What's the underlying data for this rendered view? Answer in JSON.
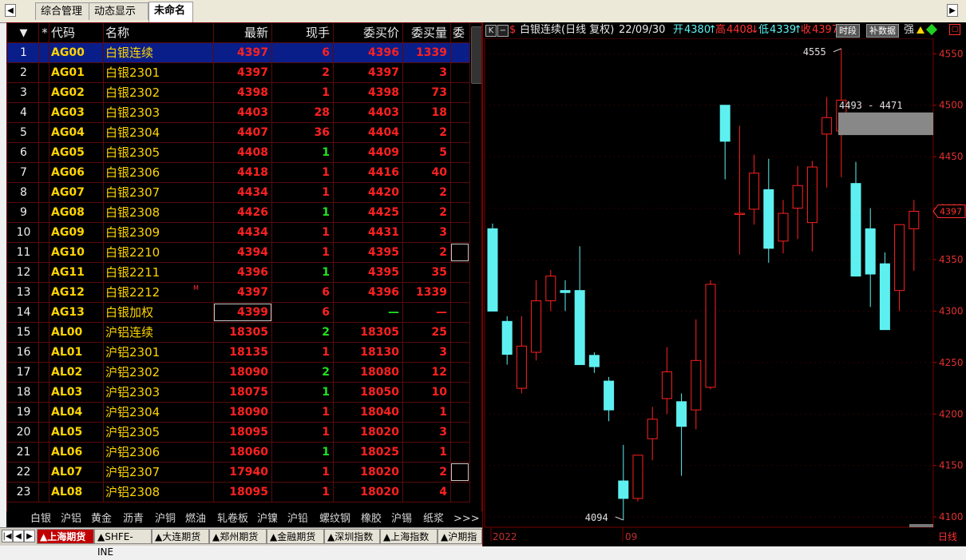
{
  "tabs": [
    {
      "label": "综合管理",
      "active": false
    },
    {
      "label": "动态显示牌",
      "active": false
    },
    {
      "label": "未命名",
      "active": true
    }
  ],
  "table": {
    "headers": [
      "▼",
      "*",
      "代码",
      "名称",
      "最新",
      "现手",
      "委买价",
      "委买量",
      "委"
    ],
    "rows": [
      {
        "idx": "1",
        "code": "AG00",
        "name": "白银连续",
        "last": "4397",
        "vol": "6",
        "vol_color": "#ff2020",
        "bid": "4396",
        "bidvol": "1339"
      },
      {
        "idx": "2",
        "code": "AG01",
        "name": "白银2301",
        "last": "4397",
        "vol": "2",
        "vol_color": "#ff2020",
        "bid": "4397",
        "bidvol": "3"
      },
      {
        "idx": "3",
        "code": "AG02",
        "name": "白银2302",
        "last": "4398",
        "vol": "1",
        "vol_color": "#ff2020",
        "bid": "4398",
        "bidvol": "73"
      },
      {
        "idx": "4",
        "code": "AG03",
        "name": "白银2303",
        "last": "4403",
        "vol": "28",
        "vol_color": "#ff2020",
        "bid": "4403",
        "bidvol": "18"
      },
      {
        "idx": "5",
        "code": "AG04",
        "name": "白银2304",
        "last": "4407",
        "vol": "36",
        "vol_color": "#ff2020",
        "bid": "4404",
        "bidvol": "2"
      },
      {
        "idx": "6",
        "code": "AG05",
        "name": "白银2305",
        "last": "4408",
        "vol": "1",
        "vol_color": "#20e020",
        "bid": "4409",
        "bidvol": "5"
      },
      {
        "idx": "7",
        "code": "AG06",
        "name": "白银2306",
        "last": "4418",
        "vol": "1",
        "vol_color": "#ff2020",
        "bid": "4416",
        "bidvol": "40"
      },
      {
        "idx": "8",
        "code": "AG07",
        "name": "白银2307",
        "last": "4434",
        "vol": "1",
        "vol_color": "#ff2020",
        "bid": "4420",
        "bidvol": "2"
      },
      {
        "idx": "9",
        "code": "AG08",
        "name": "白银2308",
        "last": "4426",
        "vol": "1",
        "vol_color": "#20e020",
        "bid": "4425",
        "bidvol": "2"
      },
      {
        "idx": "10",
        "code": "AG09",
        "name": "白银2309",
        "last": "4434",
        "vol": "1",
        "vol_color": "#ff2020",
        "bid": "4431",
        "bidvol": "3"
      },
      {
        "idx": "11",
        "code": "AG10",
        "name": "白银2210",
        "last": "4394",
        "vol": "1",
        "vol_color": "#ff2020",
        "bid": "4395",
        "bidvol": "2"
      },
      {
        "idx": "12",
        "code": "AG11",
        "name": "白银2211",
        "last": "4396",
        "vol": "1",
        "vol_color": "#20e020",
        "bid": "4395",
        "bidvol": "35"
      },
      {
        "idx": "13",
        "code": "AG12",
        "name": "白银2212",
        "tag": "M",
        "last": "4397",
        "vol": "6",
        "vol_color": "#ff2020",
        "bid": "4396",
        "bidvol": "1339"
      },
      {
        "idx": "14",
        "code": "AG13",
        "name": "白银加权",
        "last": "4399",
        "vol": "6",
        "vol_color": "#ff2020",
        "bid": "—",
        "bidvol": "—"
      },
      {
        "idx": "15",
        "code": "AL00",
        "name": "沪铝连续",
        "last": "18305",
        "vol": "2",
        "vol_color": "#20e020",
        "bid": "18305",
        "bidvol": "25"
      },
      {
        "idx": "16",
        "code": "AL01",
        "name": "沪铝2301",
        "last": "18135",
        "vol": "1",
        "vol_color": "#ff2020",
        "bid": "18130",
        "bidvol": "3"
      },
      {
        "idx": "17",
        "code": "AL02",
        "name": "沪铝2302",
        "last": "18090",
        "vol": "2",
        "vol_color": "#20e020",
        "bid": "18080",
        "bidvol": "12"
      },
      {
        "idx": "18",
        "code": "AL03",
        "name": "沪铝2303",
        "last": "18075",
        "vol": "1",
        "vol_color": "#20e020",
        "bid": "18050",
        "bidvol": "10"
      },
      {
        "idx": "19",
        "code": "AL04",
        "name": "沪铝2304",
        "last": "18090",
        "vol": "1",
        "vol_color": "#ff2020",
        "bid": "18040",
        "bidvol": "1"
      },
      {
        "idx": "20",
        "code": "AL05",
        "name": "沪铝2305",
        "last": "18095",
        "vol": "1",
        "vol_color": "#ff2020",
        "bid": "18020",
        "bidvol": "3"
      },
      {
        "idx": "21",
        "code": "AL06",
        "name": "沪铝2306",
        "last": "18060",
        "vol": "1",
        "vol_color": "#20e020",
        "bid": "18025",
        "bidvol": "1"
      },
      {
        "idx": "22",
        "code": "AL07",
        "name": "沪铝2307",
        "last": "17940",
        "vol": "1",
        "vol_color": "#ff2020",
        "bid": "18020",
        "bidvol": "2"
      },
      {
        "idx": "23",
        "code": "AL08",
        "name": "沪铝2308",
        "last": "18095",
        "vol": "1",
        "vol_color": "#ff2020",
        "bid": "18020",
        "bidvol": "4"
      }
    ]
  },
  "categories": [
    "白银",
    "沪铝",
    "黄金",
    "沥青",
    "沪铜",
    "燃油",
    "轧卷板",
    "沪镍",
    "沪铅",
    "螺纹钢",
    "橡胶",
    "沪锡",
    "纸浆",
    ">>>"
  ],
  "markets": [
    "▲上海期货",
    "▲SHFE-INE",
    "▲大连期货",
    "▲郑州期货",
    "▲金融期货",
    "▲深圳指数",
    "▲上海指数",
    "▲沪期指"
  ],
  "chart_header": {
    "k_label": "K",
    "minus": "−",
    "s": "$",
    "title": "白银连续(日线 复权)",
    "date": "22/09/30",
    "open_label": "开",
    "open": "4380",
    "high_label": "高",
    "high": "4408",
    "low_label": "低",
    "low": "4339",
    "close_label": "收",
    "close": "4397",
    "btn_time": "时段",
    "btn_fill": "补数据",
    "suffix": "强"
  },
  "chart_annotations": {
    "high_mark": "4555",
    "low_mark": "4094",
    "range_box": "4493 - 4471",
    "current_price": "4397",
    "x_left": "2022",
    "x_mid": "09",
    "period": "日线"
  },
  "colors": {
    "up": "#ff2020",
    "down": "#5ef0f0",
    "grid": "#7a0000",
    "accent": "#ff2020"
  },
  "chart_data": {
    "type": "candlestick",
    "ylim": [
      4090,
      4565
    ],
    "yticks": [
      4100,
      4150,
      4200,
      4250,
      4300,
      4350,
      4397,
      4400,
      4450,
      4500,
      4550
    ],
    "candles": [
      {
        "o": 4380,
        "h": 4385,
        "l": 4300,
        "c": 4300
      },
      {
        "o": 4290,
        "h": 4295,
        "l": 4248,
        "c": 4258
      },
      {
        "o": 4225,
        "h": 4295,
        "l": 4220,
        "c": 4266
      },
      {
        "o": 4260,
        "h": 4330,
        "l": 4252,
        "c": 4310
      },
      {
        "o": 4310,
        "h": 4340,
        "l": 4300,
        "c": 4334
      },
      {
        "o": 4320,
        "h": 4330,
        "l": 4300,
        "c": 4318
      },
      {
        "o": 4320,
        "h": 4363,
        "l": 4248,
        "c": 4248
      },
      {
        "o": 4257,
        "h": 4260,
        "l": 4240,
        "c": 4246
      },
      {
        "o": 4232,
        "h": 4236,
        "l": 4193,
        "c": 4204
      },
      {
        "o": 4135,
        "h": 4170,
        "l": 4097,
        "c": 4118
      },
      {
        "o": 4118,
        "h": 4160,
        "l": 4115,
        "c": 4160
      },
      {
        "o": 4176,
        "h": 4207,
        "l": 4155,
        "c": 4195
      },
      {
        "o": 4215,
        "h": 4265,
        "l": 4200,
        "c": 4241
      },
      {
        "o": 4212,
        "h": 4220,
        "l": 4140,
        "c": 4188
      },
      {
        "o": 4204,
        "h": 4292,
        "l": 4185,
        "c": 4252
      },
      {
        "o": 4226,
        "h": 4330,
        "l": 4224,
        "c": 4326
      },
      {
        "o": 4500,
        "h": 4500,
        "l": 4428,
        "c": 4465
      },
      {
        "o": 4395,
        "h": 4480,
        "l": 4355,
        "c": 4395
      },
      {
        "o": 4399,
        "h": 4452,
        "l": 4384,
        "c": 4434
      },
      {
        "o": 4418,
        "h": 4448,
        "l": 4347,
        "c": 4361
      },
      {
        "o": 4368,
        "h": 4408,
        "l": 4356,
        "c": 4395
      },
      {
        "o": 4400,
        "h": 4441,
        "l": 4370,
        "c": 4422
      },
      {
        "o": 4386,
        "h": 4446,
        "l": 4358,
        "c": 4440
      },
      {
        "o": 4472,
        "h": 4508,
        "l": 4420,
        "c": 4488
      },
      {
        "o": 4475,
        "h": 4555,
        "l": 4430,
        "c": 4505
      },
      {
        "o": 4424,
        "h": 4445,
        "l": 4370,
        "c": 4334
      },
      {
        "o": 4380,
        "h": 4400,
        "l": 4304,
        "c": 4336
      },
      {
        "o": 4346,
        "h": 4357,
        "l": 4282,
        "c": 4282
      },
      {
        "o": 4320,
        "h": 4383,
        "l": 4300,
        "c": 4384
      },
      {
        "o": 4380,
        "h": 4408,
        "l": 4339,
        "c": 4397
      }
    ]
  }
}
